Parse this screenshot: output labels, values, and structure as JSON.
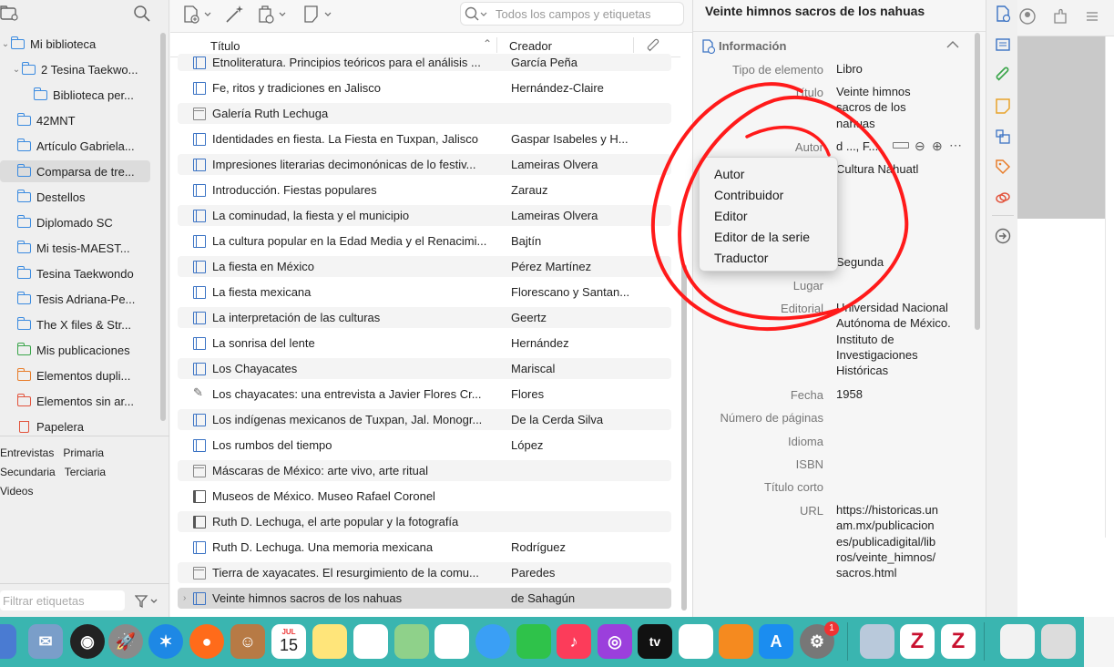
{
  "left_pane": {
    "collections": [
      {
        "label": "Mi biblioteca",
        "icon": "library-icon"
      },
      {
        "label": "2 Tesina Taekwo...",
        "icon": "folder-icon"
      },
      {
        "label": "Biblioteca per...",
        "icon": "folder-icon"
      },
      {
        "label": "42MNT",
        "icon": "folder-icon"
      },
      {
        "label": "Artículo Gabriela...",
        "icon": "folder-icon"
      },
      {
        "label": "Comparsa de tre...",
        "icon": "folder-icon"
      },
      {
        "label": "Destellos",
        "icon": "folder-icon"
      },
      {
        "label": "Diplomado SC",
        "icon": "folder-icon"
      },
      {
        "label": "Mi tesis-MAEST...",
        "icon": "folder-icon"
      },
      {
        "label": "Tesina Taekwondo",
        "icon": "folder-icon"
      },
      {
        "label": "Tesis Adriana-Pe...",
        "icon": "folder-icon"
      },
      {
        "label": "The X files & Str...",
        "icon": "folder-icon"
      },
      {
        "label": "Mis publicaciones",
        "icon": "publications-icon"
      },
      {
        "label": "Elementos dupli...",
        "icon": "duplicates-icon"
      },
      {
        "label": "Elementos sin ar...",
        "icon": "unfiled-icon"
      },
      {
        "label": "Papelera",
        "icon": "trash-icon"
      }
    ],
    "tags": [
      "Entrevistas",
      "Primaria",
      "Secundaria",
      "Terciaria",
      "Videos"
    ],
    "tag_filter_placeholder": "Filtrar etiquetas"
  },
  "items_pane": {
    "search_placeholder": "Todos los campos y etiquetas",
    "col_title": "Título",
    "col_creator": "Creador",
    "rows": [
      {
        "title": "Etnoliteratura. Principios teóricos para el análisis ...",
        "creator": "García Peña",
        "type": "book"
      },
      {
        "title": "Fe, ritos y tradiciones en Jalisco",
        "creator": "Hernández-Claire",
        "type": "book"
      },
      {
        "title": "Galería Ruth Lechuga",
        "creator": "",
        "type": "web"
      },
      {
        "title": "Identidades en fiesta. La Fiesta en Tuxpan, Jalisco",
        "creator": "Gaspar Isabeles y H...",
        "type": "book"
      },
      {
        "title": "Impresiones literarias decimonónicas de lo festiv...",
        "creator": "Lameiras Olvera",
        "type": "book"
      },
      {
        "title": "Introducción. Fiestas populares",
        "creator": "Zarauz",
        "type": "book"
      },
      {
        "title": "La cominudad, la fiesta y el municipio",
        "creator": "Lameiras Olvera",
        "type": "book"
      },
      {
        "title": "La cultura popular en la Edad Media y el Renacimi...",
        "creator": "Bajtín",
        "type": "book"
      },
      {
        "title": "La fiesta en México",
        "creator": "Pérez Martínez",
        "type": "book"
      },
      {
        "title": "La fiesta mexicana",
        "creator": "Florescano y Santan...",
        "type": "book"
      },
      {
        "title": "La interpretación de las culturas",
        "creator": "Geertz",
        "type": "book"
      },
      {
        "title": "La sonrisa del lente",
        "creator": "Hernández",
        "type": "book"
      },
      {
        "title": "Los Chayacates",
        "creator": "Mariscal",
        "type": "book"
      },
      {
        "title": "Los chayacates: una entrevista a Javier Flores Cr...",
        "creator": "Flores",
        "type": "interview"
      },
      {
        "title": "Los indígenas mexicanos de Tuxpan, Jal. Monogr...",
        "creator": "De la Cerda Silva",
        "type": "book"
      },
      {
        "title": "Los rumbos del tiempo",
        "creator": "López",
        "type": "book"
      },
      {
        "title": "Máscaras de México: arte vivo, arte ritual",
        "creator": "",
        "type": "web"
      },
      {
        "title": "Museos de México. Museo Rafael Coronel",
        "creator": "",
        "type": "film"
      },
      {
        "title": "Ruth D. Lechuga, el arte popular y la fotografía",
        "creator": "",
        "type": "film"
      },
      {
        "title": "Ruth D. Lechuga. Una memoria mexicana",
        "creator": "Rodríguez",
        "type": "book"
      },
      {
        "title": "Tierra de xayacates. El resurgimiento de la comu...",
        "creator": "Paredes",
        "type": "web"
      },
      {
        "title": "Veinte himnos sacros de los nahuas",
        "creator": "de Sahagún",
        "type": "book"
      }
    ]
  },
  "item_pane": {
    "header_title": "Veinte himnos sacros de los nahuas",
    "section_title": "Información",
    "fields": {
      "tipo_label": "Tipo de elemento",
      "tipo_value": "Libro",
      "titulo_label": "Título",
      "titulo_value": "Veinte himnos sacros de los nahuas",
      "autor_label": "Autor",
      "autor_value": "d ...,  F...",
      "autor2_value": "Cultura Náhuatl",
      "edicion_value": "Segunda",
      "lugar_label": "Lugar",
      "editorial_label": "Editorial",
      "editorial_value": "Universidad Nacional Autónoma de México. Instituto de Investigaciones Históricas",
      "fecha_label": "Fecha",
      "fecha_value": "1958",
      "paginas_label": "Número de páginas",
      "idioma_label": "Idioma",
      "isbn_label": "ISBN",
      "titulo_corto_label": "Título corto",
      "url_label": "URL",
      "url_value": "https://historicas.unam.mx/publicaciones/publicadigital/libros/veinte_himnos/sacros.html"
    }
  },
  "creator_type_menu": [
    "Autor",
    "Contribuidor",
    "Editor",
    "Editor de la serie",
    "Traductor"
  ],
  "dock": {
    "calendar_month": "JUL",
    "calendar_day": "15",
    "appletv_label": "tv",
    "badge_count": "1",
    "zotero_letter": "Z"
  }
}
